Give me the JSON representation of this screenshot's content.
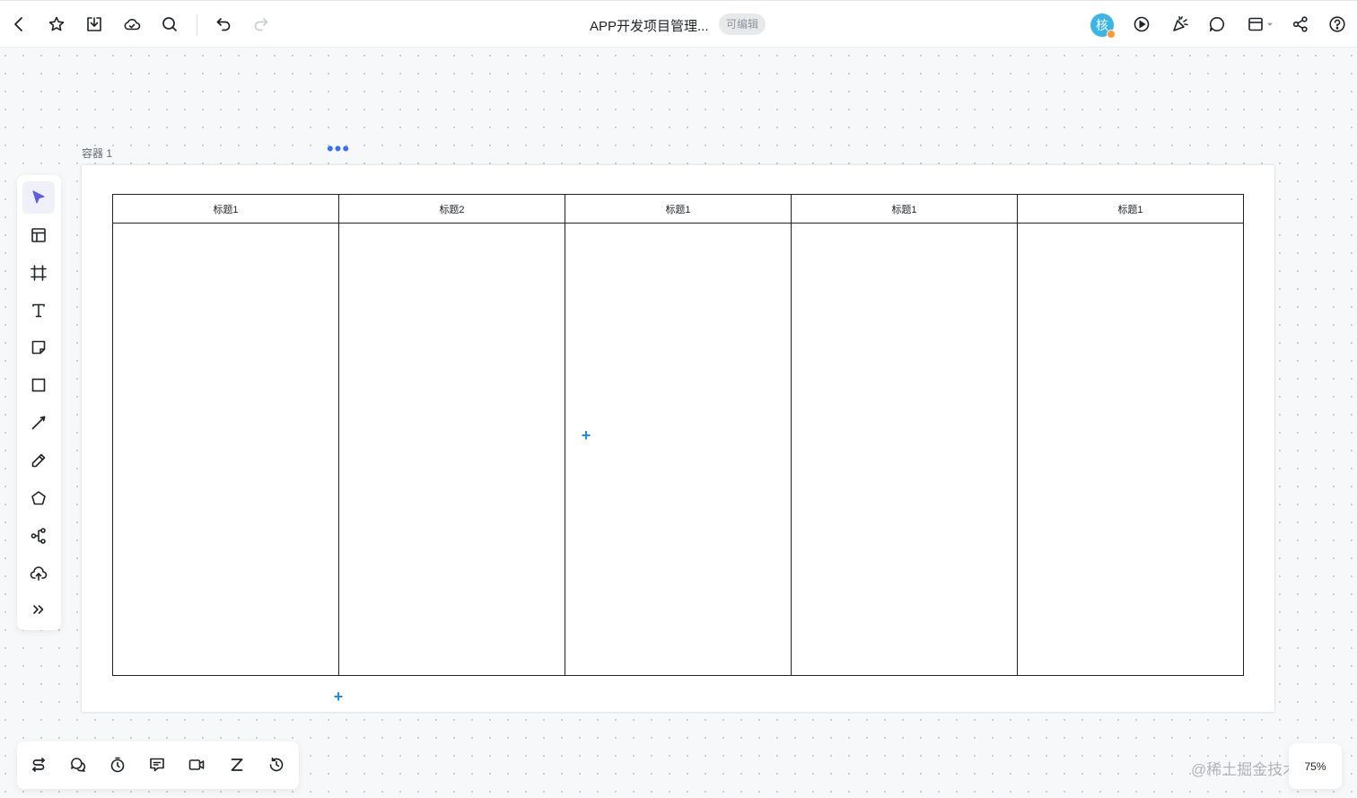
{
  "topbar": {
    "title": "APP开发项目管理...",
    "edit_badge": "可编辑",
    "avatar_text": "核"
  },
  "container": {
    "label": "容器 1",
    "more_label": "•••"
  },
  "kanban": {
    "columns": [
      {
        "title": "标题1"
      },
      {
        "title": "标题2"
      },
      {
        "title": "标题1"
      },
      {
        "title": "标题1"
      },
      {
        "title": "标题1"
      }
    ]
  },
  "add_symbol": "+",
  "zoom": "75%",
  "watermark": "@稀土掘金技术社区",
  "colors": {
    "accent": "#3370ff",
    "pointer_active": "#5b5fe8",
    "plus_blue": "#1b8ee8",
    "avatar_bg": "#3ab5e8",
    "avatar_status": "#ff9a2e"
  },
  "icons": {
    "topbar": [
      "back-icon",
      "star-icon",
      "download-icon",
      "cloud-icon",
      "search-icon",
      "undo-icon",
      "redo-icon",
      "present-icon",
      "celebrate-icon",
      "comment-icon",
      "layout-icon",
      "share-icon",
      "help-icon"
    ],
    "left_toolbar": [
      "select-icon",
      "template-icon",
      "frame-icon",
      "text-icon",
      "sticky-note-icon",
      "rectangle-icon",
      "line-icon",
      "pen-icon",
      "polygon-icon",
      "mindmap-icon",
      "upload-icon",
      "more-tools-icon"
    ],
    "bottom_toolbar": [
      "flow-icon",
      "chat-icon",
      "timer-icon",
      "comment-icon",
      "video-icon",
      "z-icon",
      "history-icon"
    ]
  }
}
